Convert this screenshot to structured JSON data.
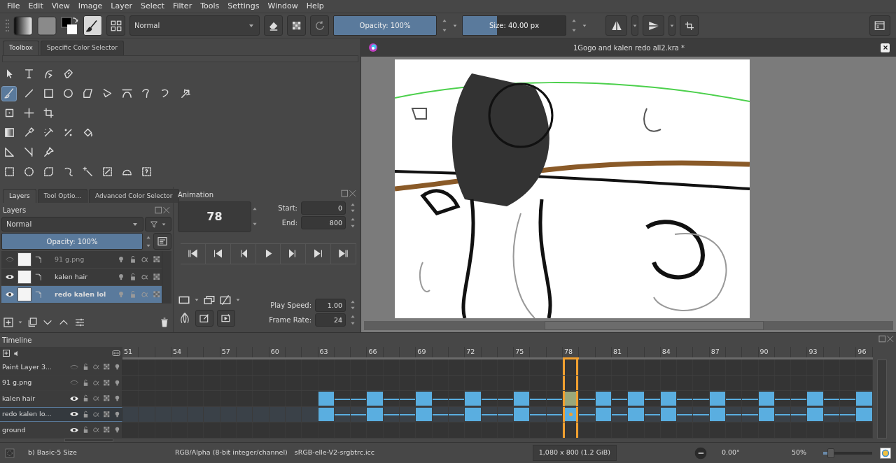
{
  "menu": [
    "File",
    "Edit",
    "View",
    "Image",
    "Layer",
    "Select",
    "Filter",
    "Tools",
    "Settings",
    "Window",
    "Help"
  ],
  "toolbar": {
    "blend_mode": "Normal",
    "opacity": {
      "label": "Opacity: 100%",
      "level": 1.0
    },
    "size": {
      "label": "Size: 40.00 px",
      "level": 0.33
    }
  },
  "left_tabs": [
    {
      "label": "Toolbox",
      "selected": true
    },
    {
      "label": "Specific Color Selector",
      "selected": false
    }
  ],
  "toolbox": [
    [
      {
        "selected": false
      },
      {
        "selected": false
      },
      {
        "selected": false
      },
      {
        "selected": false
      }
    ],
    [
      {
        "selected": true
      },
      {
        "selected": false
      },
      {
        "selected": false
      },
      {
        "selected": false
      },
      {
        "selected": false
      },
      {
        "selected": false
      },
      {
        "selected": false
      },
      {
        "selected": false
      },
      {
        "selected": false
      },
      {
        "selected": false
      }
    ],
    [
      {
        "selected": false
      },
      {
        "selected": false
      },
      {
        "selected": false
      }
    ],
    [
      {
        "selected": false
      },
      {
        "selected": false
      },
      {
        "selected": false
      },
      {
        "selected": false
      },
      {
        "selected": false
      }
    ],
    [
      {
        "selected": false
      },
      {
        "selected": false
      },
      {
        "selected": false
      }
    ],
    [
      {
        "selected": false
      },
      {
        "selected": false
      },
      {
        "selected": false
      },
      {
        "selected": false
      },
      {
        "selected": false
      },
      {
        "selected": false
      },
      {
        "selected": false
      },
      {
        "selected": false
      }
    ]
  ],
  "dock_tabs": [
    {
      "label": "Layers",
      "selected": true
    },
    {
      "label": "Tool Optio...",
      "selected": false
    },
    {
      "label": "Advanced Color Selector",
      "selected": false
    }
  ],
  "layers": {
    "title": "Layers",
    "blend_mode": "Normal",
    "opacity": {
      "label": "Opacity:  100%",
      "level": 1.0
    },
    "items": [
      {
        "name": "91 g.png",
        "visible": false,
        "selected": false
      },
      {
        "name": "kalen hair",
        "visible": true,
        "selected": false
      },
      {
        "name": "redo kalen lol",
        "visible": true,
        "selected": true
      }
    ]
  },
  "animation": {
    "title": "Animation",
    "current_frame": "78",
    "start_label": "Start:",
    "start": "0",
    "end_label": "End:",
    "end": "800",
    "speed_label": "Play Speed:",
    "speed": "1.00",
    "rate_label": "Frame Rate:",
    "rate": "24"
  },
  "document": {
    "title": "1Gogo and kalen redo all2.kra *"
  },
  "timeline": {
    "title": "Timeline",
    "frames": [
      {
        "label": "51",
        "selected": false
      },
      {
        "selected": false
      },
      {
        "selected": false
      },
      {
        "label": "54",
        "selected": false
      },
      {
        "selected": false
      },
      {
        "selected": false
      },
      {
        "label": "57",
        "selected": false
      },
      {
        "selected": false
      },
      {
        "selected": false
      },
      {
        "label": "60",
        "selected": false
      },
      {
        "selected": false
      },
      {
        "selected": false
      },
      {
        "label": "63",
        "selected": false
      },
      {
        "selected": false
      },
      {
        "selected": false
      },
      {
        "label": "66",
        "selected": false
      },
      {
        "selected": false
      },
      {
        "selected": false
      },
      {
        "label": "69",
        "selected": false
      },
      {
        "selected": false
      },
      {
        "selected": false
      },
      {
        "label": "72",
        "selected": false
      },
      {
        "selected": false
      },
      {
        "selected": false
      },
      {
        "label": "75",
        "selected": false
      },
      {
        "selected": false
      },
      {
        "selected": false
      },
      {
        "label": "78",
        "selected": true
      },
      {
        "selected": false
      },
      {
        "selected": false
      },
      {
        "label": "81",
        "selected": false
      },
      {
        "selected": false
      },
      {
        "selected": false
      },
      {
        "label": "84",
        "selected": false
      },
      {
        "selected": false
      },
      {
        "selected": false
      },
      {
        "label": "87",
        "selected": false
      },
      {
        "selected": false
      },
      {
        "selected": false
      },
      {
        "label": "90",
        "selected": false
      },
      {
        "selected": false
      },
      {
        "selected": false
      },
      {
        "label": "93",
        "selected": false
      },
      {
        "selected": false
      },
      {
        "selected": false
      },
      {
        "label": "96",
        "selected": false
      }
    ],
    "rows": [
      {
        "name": "Paint Layer 3...",
        "visible": false,
        "selected": false
      },
      {
        "name": "91 g.png",
        "visible": false,
        "selected": false
      },
      {
        "name": "kalen hair",
        "visible": true,
        "selected": false,
        "keyframes": [
          false,
          false,
          false,
          false,
          false,
          false,
          false,
          false,
          false,
          false,
          false,
          false,
          true,
          false,
          false,
          true,
          false,
          false,
          true,
          false,
          false,
          true,
          false,
          false,
          true,
          false,
          false,
          true,
          false,
          true,
          false,
          true,
          false,
          true,
          false,
          false,
          true,
          false,
          false,
          true,
          false,
          false,
          true,
          false,
          false,
          true
        ]
      },
      {
        "name": "redo kalen lo...",
        "visible": true,
        "selected": true,
        "keyframes": [
          false,
          false,
          false,
          false,
          false,
          false,
          false,
          false,
          false,
          false,
          false,
          false,
          true,
          false,
          false,
          true,
          false,
          false,
          true,
          false,
          false,
          true,
          false,
          false,
          true,
          false,
          false,
          true,
          false,
          true,
          false,
          true,
          false,
          true,
          false,
          false,
          true,
          false,
          false,
          true,
          false,
          false,
          true,
          false,
          false,
          true
        ]
      },
      {
        "name": "ground",
        "visible": true,
        "selected": false
      }
    ]
  },
  "status_bar": {
    "brush": "b) Basic-5 Size",
    "color_space": "RGB/Alpha (8-bit integer/channel)",
    "profile": "sRGB-elle-V2-srgbtrc.icc",
    "image_size": "1,080 x 800 (1.2 GiB)",
    "rotation": "0.00°",
    "zoom": "50%",
    "zoom_slider": {
      "level": 0.15
    }
  }
}
